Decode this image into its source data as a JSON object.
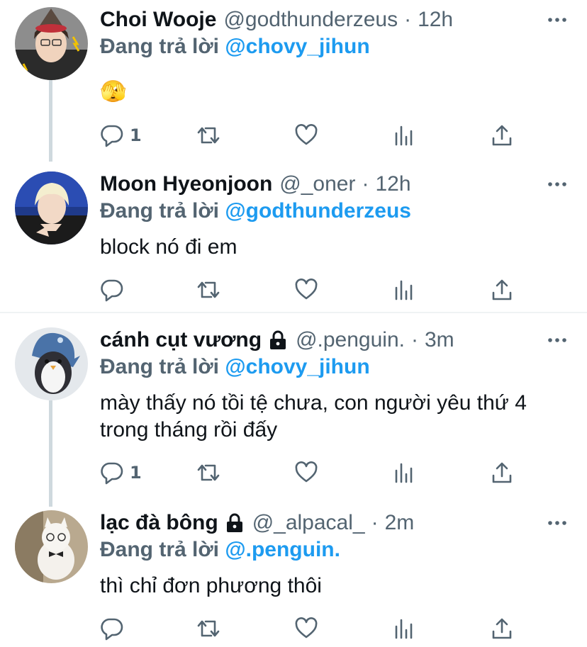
{
  "colors": {
    "accent": "#1d9bf0",
    "muted": "#536471",
    "text": "#0f1419",
    "thread_line": "#cfd9de"
  },
  "tweets": [
    {
      "name": "Choi Wooje",
      "locked": false,
      "handle": "@godthunderzeus",
      "separator": "·",
      "time": "12h",
      "reply_prefix": "Đang trả lời",
      "reply_to": "@chovy_jihun",
      "text": "🫣",
      "reply_count": "1"
    },
    {
      "name": "Moon Hyeonjoon",
      "locked": false,
      "handle": "@_oner",
      "separator": "·",
      "time": "12h",
      "reply_prefix": "Đang trả lời",
      "reply_to": "@godthunderzeus",
      "text": "block nó đi em",
      "reply_count": ""
    },
    {
      "name": "cánh cụt vương",
      "locked": true,
      "handle": "@.penguin.",
      "separator": "·",
      "time": "3m",
      "reply_prefix": "Đang trả lời",
      "reply_to": "@chovy_jihun",
      "text": "mày thấy nó tồi tệ chưa, con người yêu thứ 4 trong tháng rồi đấy",
      "reply_count": "1"
    },
    {
      "name": "lạc đà bông",
      "locked": true,
      "handle": "@_alpacal_",
      "separator": "·",
      "time": "2m",
      "reply_prefix": "Đang trả lời",
      "reply_to": "@.penguin.",
      "text": "thì chỉ đơn phương thôi",
      "reply_count": ""
    }
  ],
  "icons": [
    "reply-icon",
    "retweet-icon",
    "like-icon",
    "analytics-icon",
    "share-icon",
    "more-icon",
    "lock-icon"
  ]
}
